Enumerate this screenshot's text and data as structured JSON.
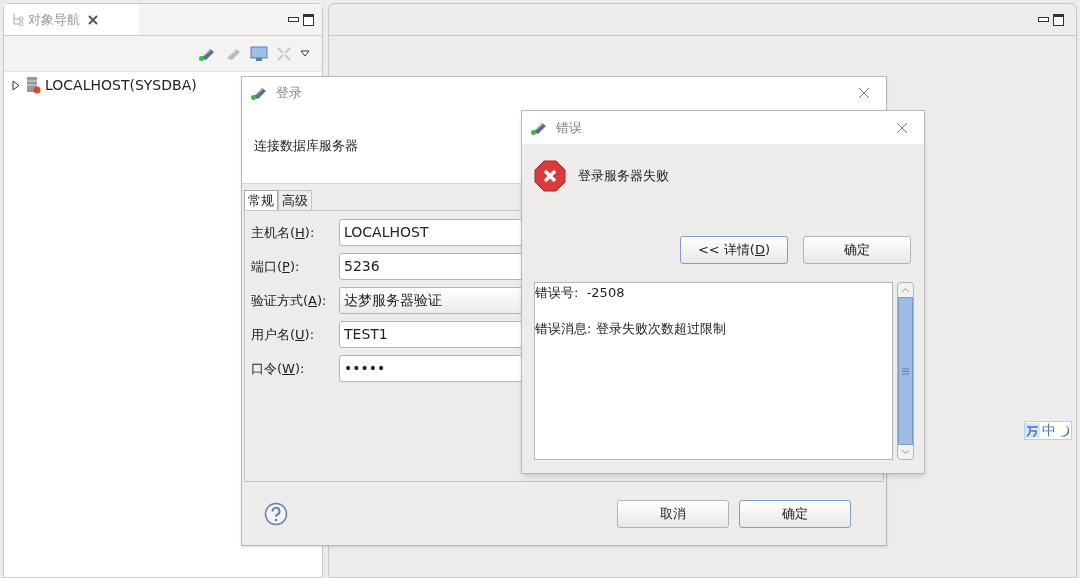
{
  "navigator": {
    "title": "对象导航",
    "tree": [
      {
        "label": "LOCALHOST(SYSDBA)",
        "expanded": false
      }
    ]
  },
  "login_dialog": {
    "title": "登录",
    "header": "连接数据库服务器",
    "tabs": [
      {
        "label": "常规",
        "selected": true
      },
      {
        "label": "高级",
        "selected": false
      }
    ],
    "fields": [
      {
        "label": "主机名(H):",
        "value": "LOCALHOST",
        "kind": "text"
      },
      {
        "label": "端口(P):",
        "value": "5236",
        "kind": "text"
      },
      {
        "label": "验证方式(A):",
        "value": "达梦服务器验证",
        "kind": "select"
      },
      {
        "label": "用户名(U):",
        "value": "TEST1",
        "kind": "text"
      },
      {
        "label": "口令(W):",
        "value": "•••••",
        "kind": "password"
      }
    ],
    "buttons": [
      {
        "label": "取消",
        "default": false
      },
      {
        "label": "确定",
        "default": true
      }
    ]
  },
  "error_dialog": {
    "title": "错误",
    "message": "登录服务器失败",
    "buttons": [
      {
        "label": "<< 详情(D)",
        "default": true
      },
      {
        "label": "确定",
        "default": false
      }
    ],
    "details": [
      "错误号:  -2508",
      "错误消息: 登录失败次数超过限制"
    ]
  },
  "ime": {
    "mode": "中"
  }
}
